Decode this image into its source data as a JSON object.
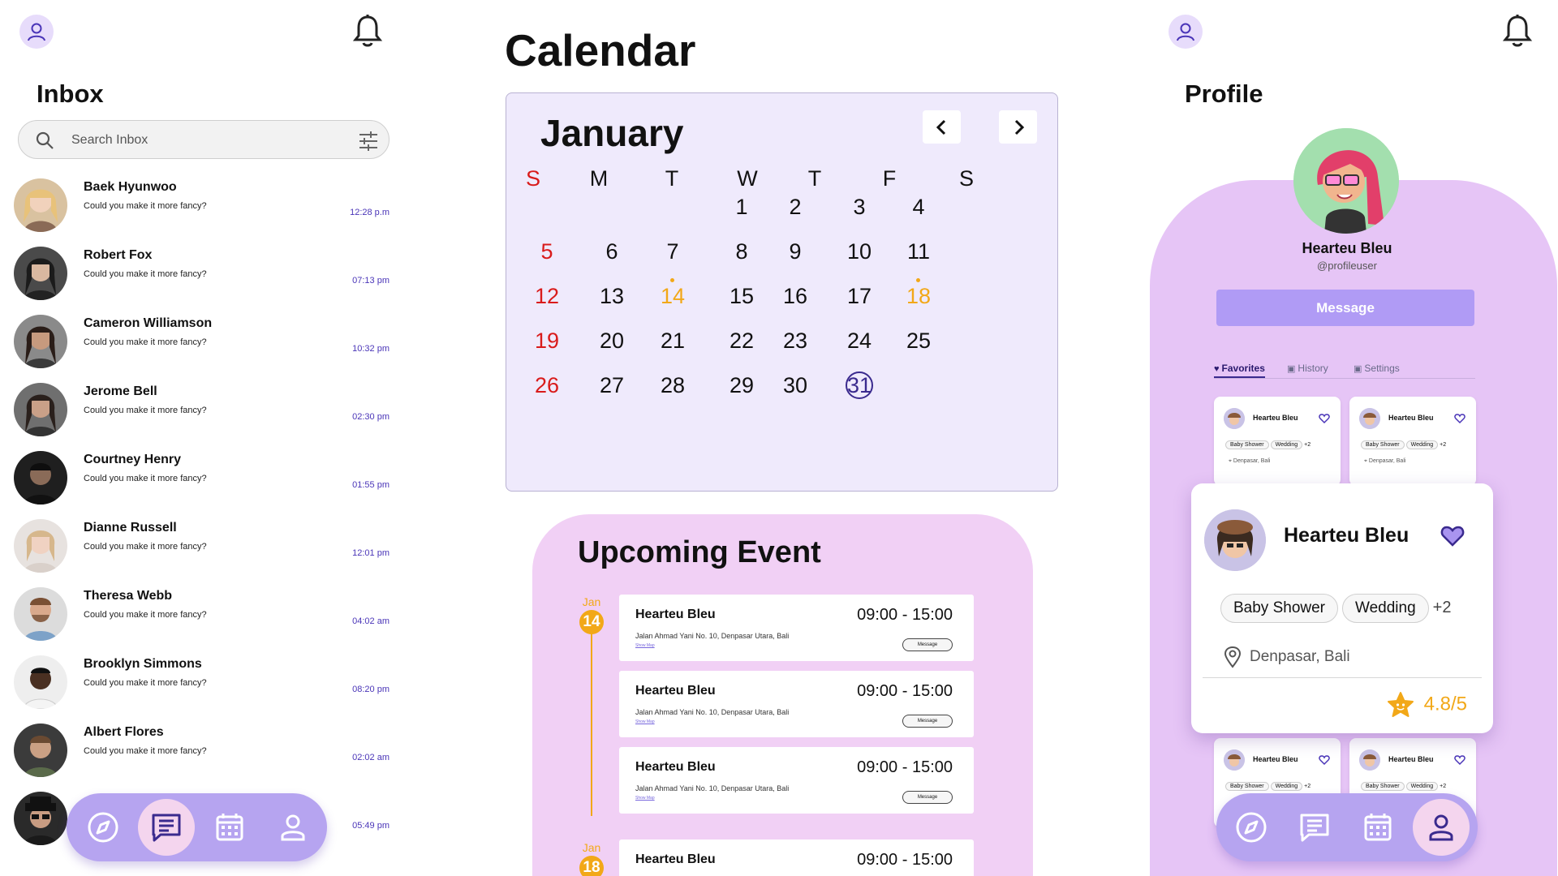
{
  "inbox": {
    "title": "Inbox",
    "search_placeholder": "Search Inbox",
    "messages": [
      {
        "name": "Baek Hyunwoo",
        "preview": "Could you make it more fancy?",
        "time": "12:28 p.m"
      },
      {
        "name": "Robert Fox",
        "preview": "Could you make it more fancy?",
        "time": "07:13 pm"
      },
      {
        "name": "Cameron Williamson",
        "preview": "Could you make it more fancy?",
        "time": "10:32 pm"
      },
      {
        "name": "Jerome Bell",
        "preview": "Could you make it more fancy?",
        "time": "02:30 pm"
      },
      {
        "name": "Courtney Henry",
        "preview": "Could you make it more fancy?",
        "time": "01:55 pm"
      },
      {
        "name": "Dianne Russell",
        "preview": "Could you make it more fancy?",
        "time": "12:01 pm"
      },
      {
        "name": "Theresa Webb",
        "preview": "Could you make it more fancy?",
        "time": "04:02 am"
      },
      {
        "name": "Brooklyn Simmons",
        "preview": "Could you make it more fancy?",
        "time": "08:20 pm"
      },
      {
        "name": "Albert Flores",
        "preview": "Could you make it more fancy?",
        "time": "02:02 am"
      },
      {
        "name": "",
        "preview": "",
        "time": "05:49 pm"
      }
    ],
    "nav": {
      "active": "chat"
    }
  },
  "calendar": {
    "title": "Calendar",
    "month": "January",
    "weekdays": [
      "S",
      "M",
      "T",
      "W",
      "T",
      "F",
      "S"
    ],
    "today": 31,
    "event_days": [
      14,
      18
    ],
    "accent": "#f2a818",
    "weekend_color": "#d91b1b"
  },
  "events": {
    "title": "Upcoming Event",
    "groups": [
      {
        "month": "Jan",
        "day": "14"
      },
      {
        "month": "Jan",
        "day": "18"
      }
    ],
    "items": [
      {
        "name": "Hearteu Bleu",
        "time": "09:00 - 15:00",
        "address": "Jalan Ahmad Yani No. 10, Denpasar Utara, Bali",
        "map": "Show Map",
        "button": "Message"
      },
      {
        "name": "Hearteu Bleu",
        "time": "09:00 - 15:00",
        "address": "Jalan Ahmad Yani No. 10, Denpasar Utara, Bali",
        "map": "Show Map",
        "button": "Message"
      },
      {
        "name": "Hearteu Bleu",
        "time": "09:00 - 15:00",
        "address": "Jalan Ahmad Yani No. 10, Denpasar Utara, Bali",
        "map": "Show Map",
        "button": "Message"
      },
      {
        "name": "Hearteu Bleu",
        "time": "09:00 - 15:00",
        "address": "",
        "map": "",
        "button": ""
      }
    ]
  },
  "profile": {
    "title": "Profile",
    "name": "Hearteu Bleu",
    "handle": "@profileuser",
    "message_button": "Message",
    "tabs": [
      "Favorites",
      "History",
      "Settings"
    ],
    "mini_card": {
      "name": "Hearteu Bleu",
      "tags": [
        "Baby Shower",
        "Wedding",
        "+2"
      ],
      "location": "Denpasar, Bali"
    },
    "featured": {
      "name": "Hearteu Bleu",
      "tags": [
        "Baby Shower",
        "Wedding"
      ],
      "more": "+2",
      "location": "Denpasar, Bali",
      "rating": "4.8/5"
    },
    "nav": {
      "active": "profile"
    }
  }
}
